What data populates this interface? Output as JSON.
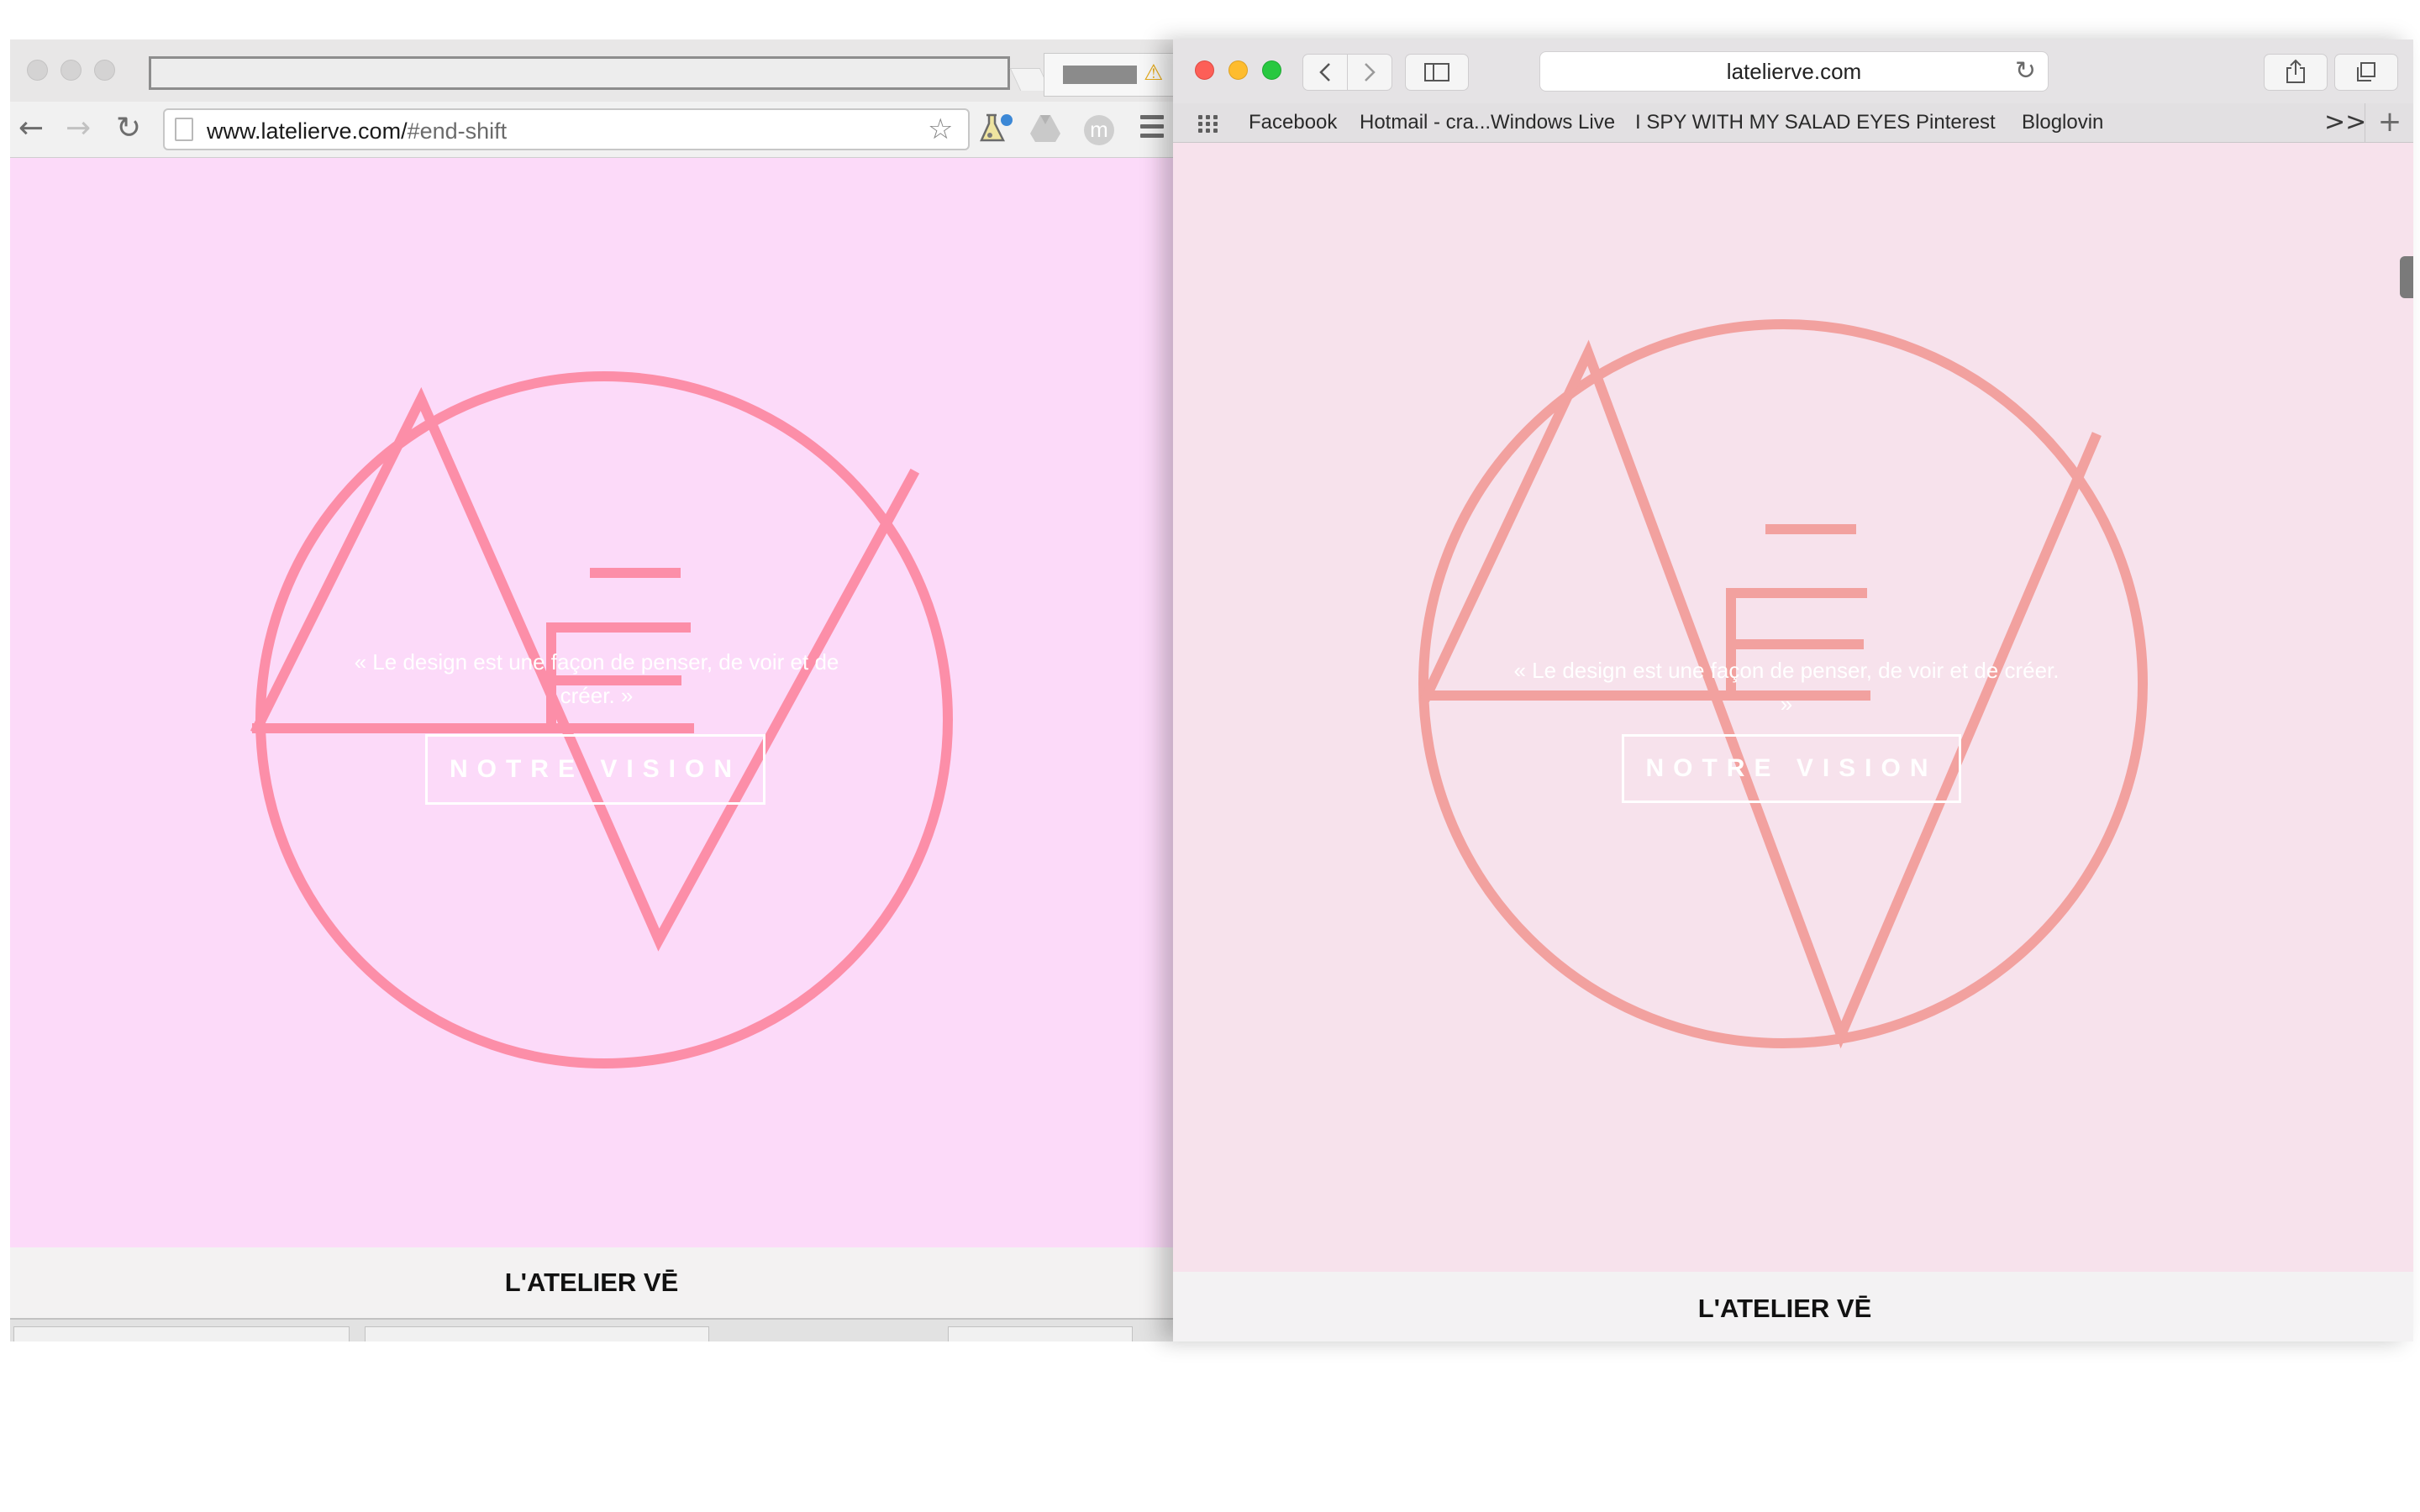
{
  "chrome": {
    "address": {
      "domain": "www.latelierve.com/",
      "fragment": "#end-shift"
    },
    "nav": {
      "back_icon": "←",
      "forward_icon": "→",
      "reload_icon": "↻"
    },
    "star_icon": "☆"
  },
  "safari": {
    "address": "latelierve.com",
    "bookmarks": [
      "Facebook",
      "Hotmail - cra...Windows Live",
      "I SPY WITH MY SALAD EYES",
      "Pinterest",
      "Bloglovin"
    ],
    "more_icon": ">>",
    "plus_icon": "+"
  },
  "hero": {
    "quote": "« Le design est une façon de penser, de voir et de créer. »",
    "button_label": "NOTRE VISION"
  },
  "site": {
    "title": "L'ATELIER VĒ"
  },
  "colors": {
    "chrome_background": "#fcdaf9",
    "chrome_logo": "#fc8ea8",
    "safari_background": "#f7e2ec",
    "safari_logo": "#f2a19f"
  }
}
